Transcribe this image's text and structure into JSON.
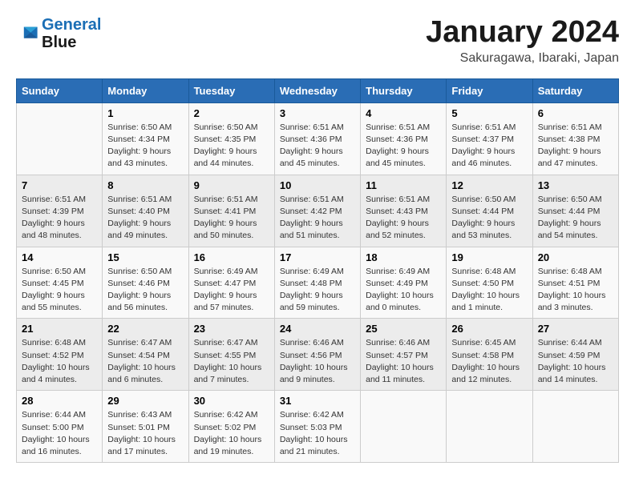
{
  "header": {
    "logo_line1": "General",
    "logo_line2": "Blue",
    "month": "January 2024",
    "location": "Sakuragawa, Ibaraki, Japan"
  },
  "weekdays": [
    "Sunday",
    "Monday",
    "Tuesday",
    "Wednesday",
    "Thursday",
    "Friday",
    "Saturday"
  ],
  "weeks": [
    [
      {
        "day": "",
        "info": ""
      },
      {
        "day": "1",
        "info": "Sunrise: 6:50 AM\nSunset: 4:34 PM\nDaylight: 9 hours\nand 43 minutes."
      },
      {
        "day": "2",
        "info": "Sunrise: 6:50 AM\nSunset: 4:35 PM\nDaylight: 9 hours\nand 44 minutes."
      },
      {
        "day": "3",
        "info": "Sunrise: 6:51 AM\nSunset: 4:36 PM\nDaylight: 9 hours\nand 45 minutes."
      },
      {
        "day": "4",
        "info": "Sunrise: 6:51 AM\nSunset: 4:36 PM\nDaylight: 9 hours\nand 45 minutes."
      },
      {
        "day": "5",
        "info": "Sunrise: 6:51 AM\nSunset: 4:37 PM\nDaylight: 9 hours\nand 46 minutes."
      },
      {
        "day": "6",
        "info": "Sunrise: 6:51 AM\nSunset: 4:38 PM\nDaylight: 9 hours\nand 47 minutes."
      }
    ],
    [
      {
        "day": "7",
        "info": "Sunrise: 6:51 AM\nSunset: 4:39 PM\nDaylight: 9 hours\nand 48 minutes."
      },
      {
        "day": "8",
        "info": "Sunrise: 6:51 AM\nSunset: 4:40 PM\nDaylight: 9 hours\nand 49 minutes."
      },
      {
        "day": "9",
        "info": "Sunrise: 6:51 AM\nSunset: 4:41 PM\nDaylight: 9 hours\nand 50 minutes."
      },
      {
        "day": "10",
        "info": "Sunrise: 6:51 AM\nSunset: 4:42 PM\nDaylight: 9 hours\nand 51 minutes."
      },
      {
        "day": "11",
        "info": "Sunrise: 6:51 AM\nSunset: 4:43 PM\nDaylight: 9 hours\nand 52 minutes."
      },
      {
        "day": "12",
        "info": "Sunrise: 6:50 AM\nSunset: 4:44 PM\nDaylight: 9 hours\nand 53 minutes."
      },
      {
        "day": "13",
        "info": "Sunrise: 6:50 AM\nSunset: 4:44 PM\nDaylight: 9 hours\nand 54 minutes."
      }
    ],
    [
      {
        "day": "14",
        "info": "Sunrise: 6:50 AM\nSunset: 4:45 PM\nDaylight: 9 hours\nand 55 minutes."
      },
      {
        "day": "15",
        "info": "Sunrise: 6:50 AM\nSunset: 4:46 PM\nDaylight: 9 hours\nand 56 minutes."
      },
      {
        "day": "16",
        "info": "Sunrise: 6:49 AM\nSunset: 4:47 PM\nDaylight: 9 hours\nand 57 minutes."
      },
      {
        "day": "17",
        "info": "Sunrise: 6:49 AM\nSunset: 4:48 PM\nDaylight: 9 hours\nand 59 minutes."
      },
      {
        "day": "18",
        "info": "Sunrise: 6:49 AM\nSunset: 4:49 PM\nDaylight: 10 hours\nand 0 minutes."
      },
      {
        "day": "19",
        "info": "Sunrise: 6:48 AM\nSunset: 4:50 PM\nDaylight: 10 hours\nand 1 minute."
      },
      {
        "day": "20",
        "info": "Sunrise: 6:48 AM\nSunset: 4:51 PM\nDaylight: 10 hours\nand 3 minutes."
      }
    ],
    [
      {
        "day": "21",
        "info": "Sunrise: 6:48 AM\nSunset: 4:52 PM\nDaylight: 10 hours\nand 4 minutes."
      },
      {
        "day": "22",
        "info": "Sunrise: 6:47 AM\nSunset: 4:54 PM\nDaylight: 10 hours\nand 6 minutes."
      },
      {
        "day": "23",
        "info": "Sunrise: 6:47 AM\nSunset: 4:55 PM\nDaylight: 10 hours\nand 7 minutes."
      },
      {
        "day": "24",
        "info": "Sunrise: 6:46 AM\nSunset: 4:56 PM\nDaylight: 10 hours\nand 9 minutes."
      },
      {
        "day": "25",
        "info": "Sunrise: 6:46 AM\nSunset: 4:57 PM\nDaylight: 10 hours\nand 11 minutes."
      },
      {
        "day": "26",
        "info": "Sunrise: 6:45 AM\nSunset: 4:58 PM\nDaylight: 10 hours\nand 12 minutes."
      },
      {
        "day": "27",
        "info": "Sunrise: 6:44 AM\nSunset: 4:59 PM\nDaylight: 10 hours\nand 14 minutes."
      }
    ],
    [
      {
        "day": "28",
        "info": "Sunrise: 6:44 AM\nSunset: 5:00 PM\nDaylight: 10 hours\nand 16 minutes."
      },
      {
        "day": "29",
        "info": "Sunrise: 6:43 AM\nSunset: 5:01 PM\nDaylight: 10 hours\nand 17 minutes."
      },
      {
        "day": "30",
        "info": "Sunrise: 6:42 AM\nSunset: 5:02 PM\nDaylight: 10 hours\nand 19 minutes."
      },
      {
        "day": "31",
        "info": "Sunrise: 6:42 AM\nSunset: 5:03 PM\nDaylight: 10 hours\nand 21 minutes."
      },
      {
        "day": "",
        "info": ""
      },
      {
        "day": "",
        "info": ""
      },
      {
        "day": "",
        "info": ""
      }
    ]
  ]
}
